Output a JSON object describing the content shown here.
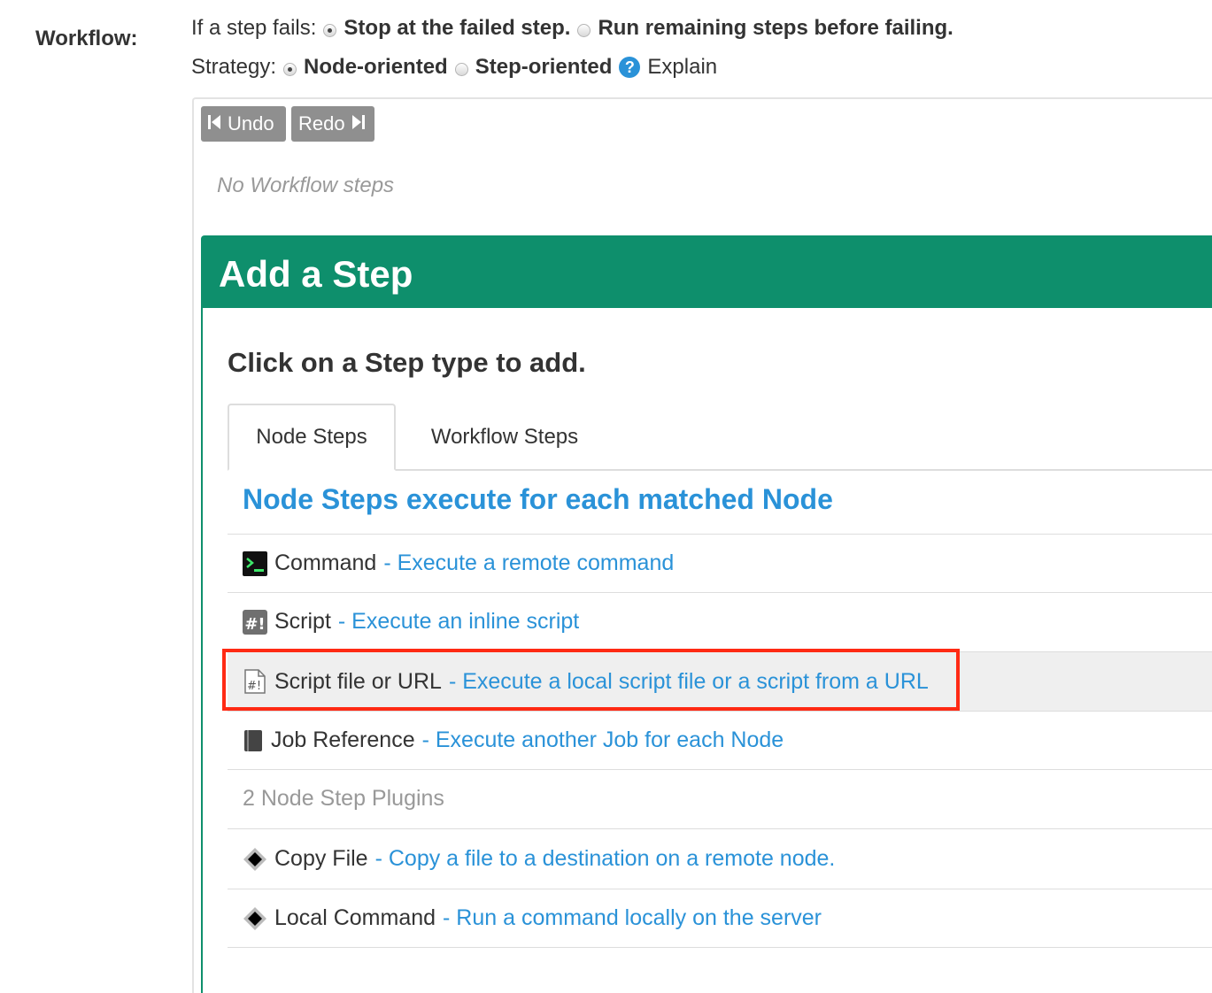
{
  "workflow": {
    "label": "Workflow:",
    "fail_prefix": "If a step fails:",
    "fail_option_1": "Stop at the failed step.",
    "fail_option_2": "Run remaining steps before failing.",
    "strategy_prefix": "Strategy:",
    "strategy_option_1": "Node-oriented",
    "strategy_option_2": "Step-oriented",
    "explain": "Explain"
  },
  "toolbar": {
    "undo_label": "Undo",
    "redo_label": "Redo"
  },
  "empty_text": "No Workflow steps",
  "add_step": {
    "title": "Add a Step",
    "instruction": "Click on a Step type to add.",
    "tabs": [
      "Node Steps",
      "Workflow Steps"
    ],
    "section_heading": "Node Steps execute for each matched Node",
    "items": [
      {
        "name": "Command",
        "desc": "- Execute a remote command",
        "icon": "terminal-icon"
      },
      {
        "name": "Script",
        "desc": "- Execute an inline script",
        "icon": "script-icon"
      },
      {
        "name": "Script file or URL",
        "desc": "- Execute a local script file or a script from a URL",
        "icon": "script-file-icon"
      },
      {
        "name": "Job Reference",
        "desc": "- Execute another Job for each Node",
        "icon": "book-icon"
      }
    ],
    "plugins_label": "2 Node Step Plugins",
    "plugins": [
      {
        "name": "Copy File",
        "desc": "- Copy a file to a destination on a remote node.",
        "icon": "diamond-icon"
      },
      {
        "name": "Local Command",
        "desc": "- Run a command locally on the server",
        "icon": "diamond-icon"
      }
    ]
  },
  "colors": {
    "accent_green": "#0e8f6c",
    "link_blue": "#2a92d8",
    "highlight_red": "#ff2a14"
  }
}
